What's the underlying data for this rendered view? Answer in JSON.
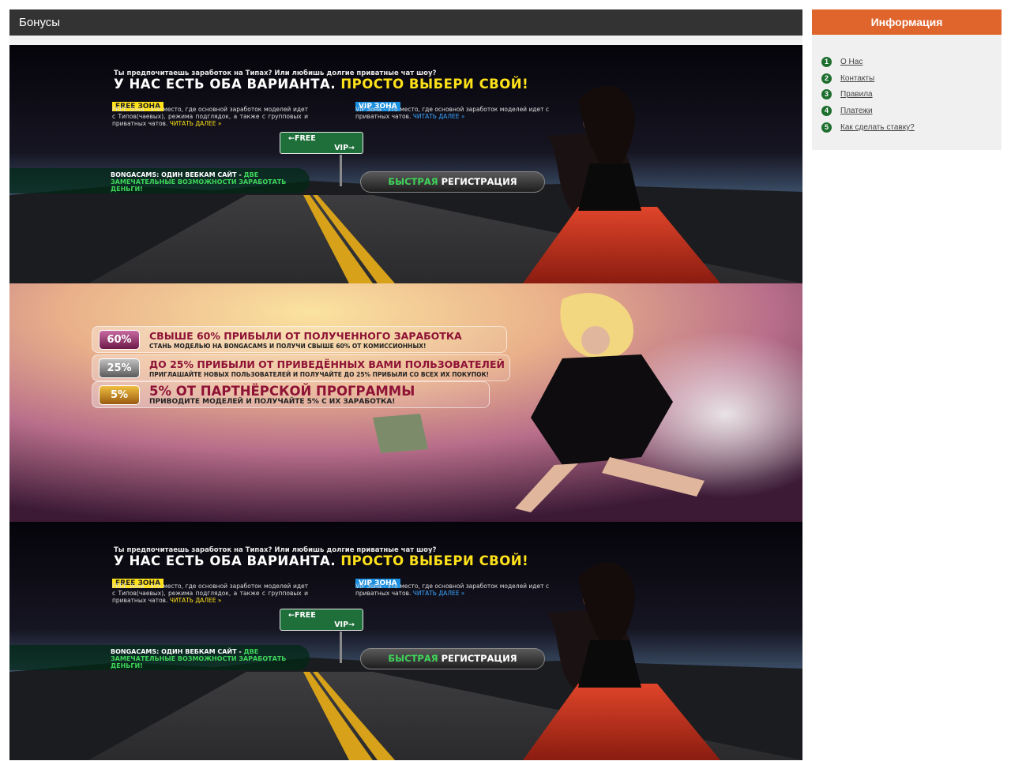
{
  "main": {
    "section_title": "Бонусы"
  },
  "banner_road": {
    "intro": "Ты предпочитаешь заработок на Типах? Или любишь долгие приватные чат шоу?",
    "headline_part1": "У НАС ЕСТЬ ОБА ВАРИАНТА. ",
    "headline_part2": "ПРОСТО ВЫБЕРИ СВОЙ!",
    "free_tag": "FREE ЗОНА",
    "free_desc": "FREE Зона - это место, где основной заработок моделей идет с Типов(чаевых), режима подглядок, а также с групповых и приватных чатов. ",
    "free_link": "ЧИТАТЬ ДАЛЕЕ »",
    "vip_tag": "VIP ЗОНА",
    "vip_desc": "VIP Зона - это место, где основной заработок моделей идет с приватных чатов. ",
    "vip_link": "ЧИТАТЬ ДАЛЕЕ »",
    "sign_free": "←FREE",
    "sign_vip": "VIP→",
    "bonga_white": "BONGACAMS: ОДИН ВЕБКАМ САЙТ - ",
    "bonga_green": "ДВЕ ЗАМЕЧАТЕЛЬНЫЕ ВОЗМОЖНОСТИ ЗАРАБОТАТЬ ДЕНЬГИ!",
    "reg_green": "БЫСТРАЯ ",
    "reg_white": "РЕГИСТРАЦИЯ"
  },
  "banner_percent": {
    "rows": [
      {
        "badge": "60%",
        "title": "СВЫШЕ 60% ПРИБЫЛИ ОТ ПОЛУЧЕННОГО ЗАРАБОТКА",
        "sub": "СТАНЬ МОДЕЛЬЮ НА BONGACAMS И ПОЛУЧИ СВЫШЕ 60% ОТ КОМИССИОННЫХ!"
      },
      {
        "badge": "25%",
        "title": "ДО 25% ПРИБЫЛИ ОТ ПРИВЕДЁННЫХ ВАМИ ПОЛЬЗОВАТЕЛЕЙ",
        "sub": "ПРИГЛАШАЙТЕ НОВЫХ ПОЛЬЗОВАТЕЛЕЙ И ПОЛУЧАЙТЕ ДО 25% ПРИБЫЛИ СО ВСЕХ ИХ ПОКУПОК!"
      },
      {
        "badge": "5%",
        "title": "5% ОТ ПАРТНЁРСКОЙ ПРОГРАММЫ",
        "sub": "ПРИВОДИТЕ МОДЕЛЕЙ И ПОЛУЧАЙТЕ 5% С ИХ ЗАРАБОТКА!"
      }
    ]
  },
  "sidebar": {
    "title": "Информация",
    "items": [
      {
        "num": "1",
        "label": "О Нас"
      },
      {
        "num": "2",
        "label": "Контакты"
      },
      {
        "num": "3",
        "label": "Правила"
      },
      {
        "num": "4",
        "label": "Платежи"
      },
      {
        "num": "5",
        "label": "Как сделать ставку?"
      }
    ]
  },
  "colors": {
    "header_bg": "#333333",
    "sidebar_accent": "#e0652d",
    "number_circle": "#1e6e2e",
    "headline_yellow": "#ffe21a",
    "bonga_green": "#3fd45a",
    "percent_title": "#8e1235"
  }
}
